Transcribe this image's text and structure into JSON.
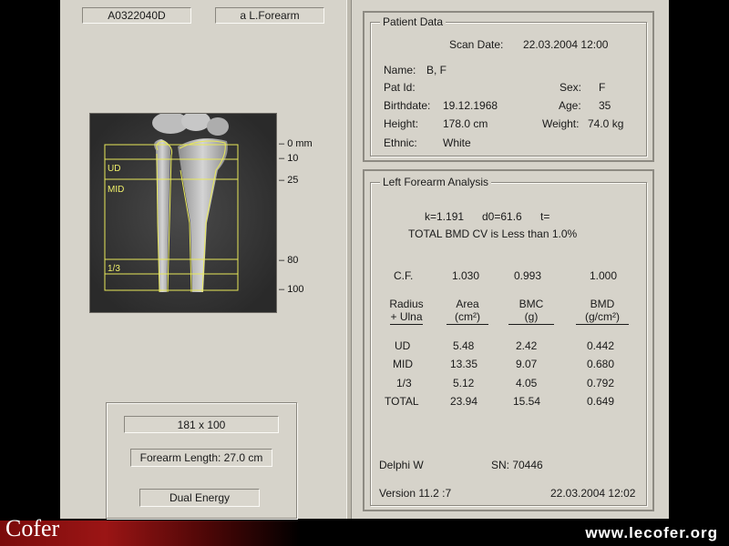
{
  "left": {
    "scan_id": "A0322040D",
    "scan_site": "a L.Forearm",
    "regions": [
      "UD",
      "MID",
      "1/3"
    ],
    "ticks": [
      "0 mm",
      "10",
      "25",
      "80",
      "100"
    ],
    "matrix": "181 x 100",
    "forearm_length": "Forearm Length:  27.0 cm",
    "mode": "Dual Energy"
  },
  "patient": {
    "legend": "Patient Data",
    "scan_date_label": "Scan Date:",
    "scan_date": "22.03.2004 12:00",
    "name_label": "Name:",
    "name": "B, F",
    "pat_id_label": "Pat Id:",
    "sex_label": "Sex:",
    "sex": "F",
    "birthdate_label": "Birthdate:",
    "birthdate": "19.12.1968",
    "age_label": "Age:",
    "age": "35",
    "height_label": "Height:",
    "height": "178.0 cm",
    "weight_label": "Weight:",
    "weight": "74.0 kg",
    "ethnic_label": "Ethnic:",
    "ethnic": "White"
  },
  "analysis": {
    "legend": "Left Forearm Analysis",
    "k": "k=1.191",
    "d0": "d0=61.6",
    "t": "t=",
    "cv_note": "TOTAL BMD CV is Less than 1.0%",
    "cf_label": "C.F.",
    "cf_values": [
      "1.030",
      "0.993",
      "1.000"
    ],
    "headers": [
      {
        "line1": "Radius",
        "line2": "+ Ulna"
      },
      {
        "line1": "Area",
        "line2": "(cm²)"
      },
      {
        "line1": "BMC",
        "line2": "(g)"
      },
      {
        "line1": "BMD",
        "line2": "(g/cm²)"
      }
    ],
    "rows": [
      {
        "region": "UD",
        "area": "5.48",
        "bmc": "2.42",
        "bmd": "0.442"
      },
      {
        "region": "MID",
        "area": "13.35",
        "bmc": "9.07",
        "bmd": "0.680"
      },
      {
        "region": "1/3",
        "area": "5.12",
        "bmc": "4.05",
        "bmd": "0.792"
      },
      {
        "region": "TOTAL",
        "area": "23.94",
        "bmc": "15.54",
        "bmd": "0.649"
      }
    ],
    "device": "Delphi W",
    "serial": "SN: 70446",
    "version": "Version  11.2  :7",
    "timestamp": "22.03.2004 12:02"
  },
  "footer": {
    "brand": "Cofer",
    "url": "www.lecofer.org"
  }
}
